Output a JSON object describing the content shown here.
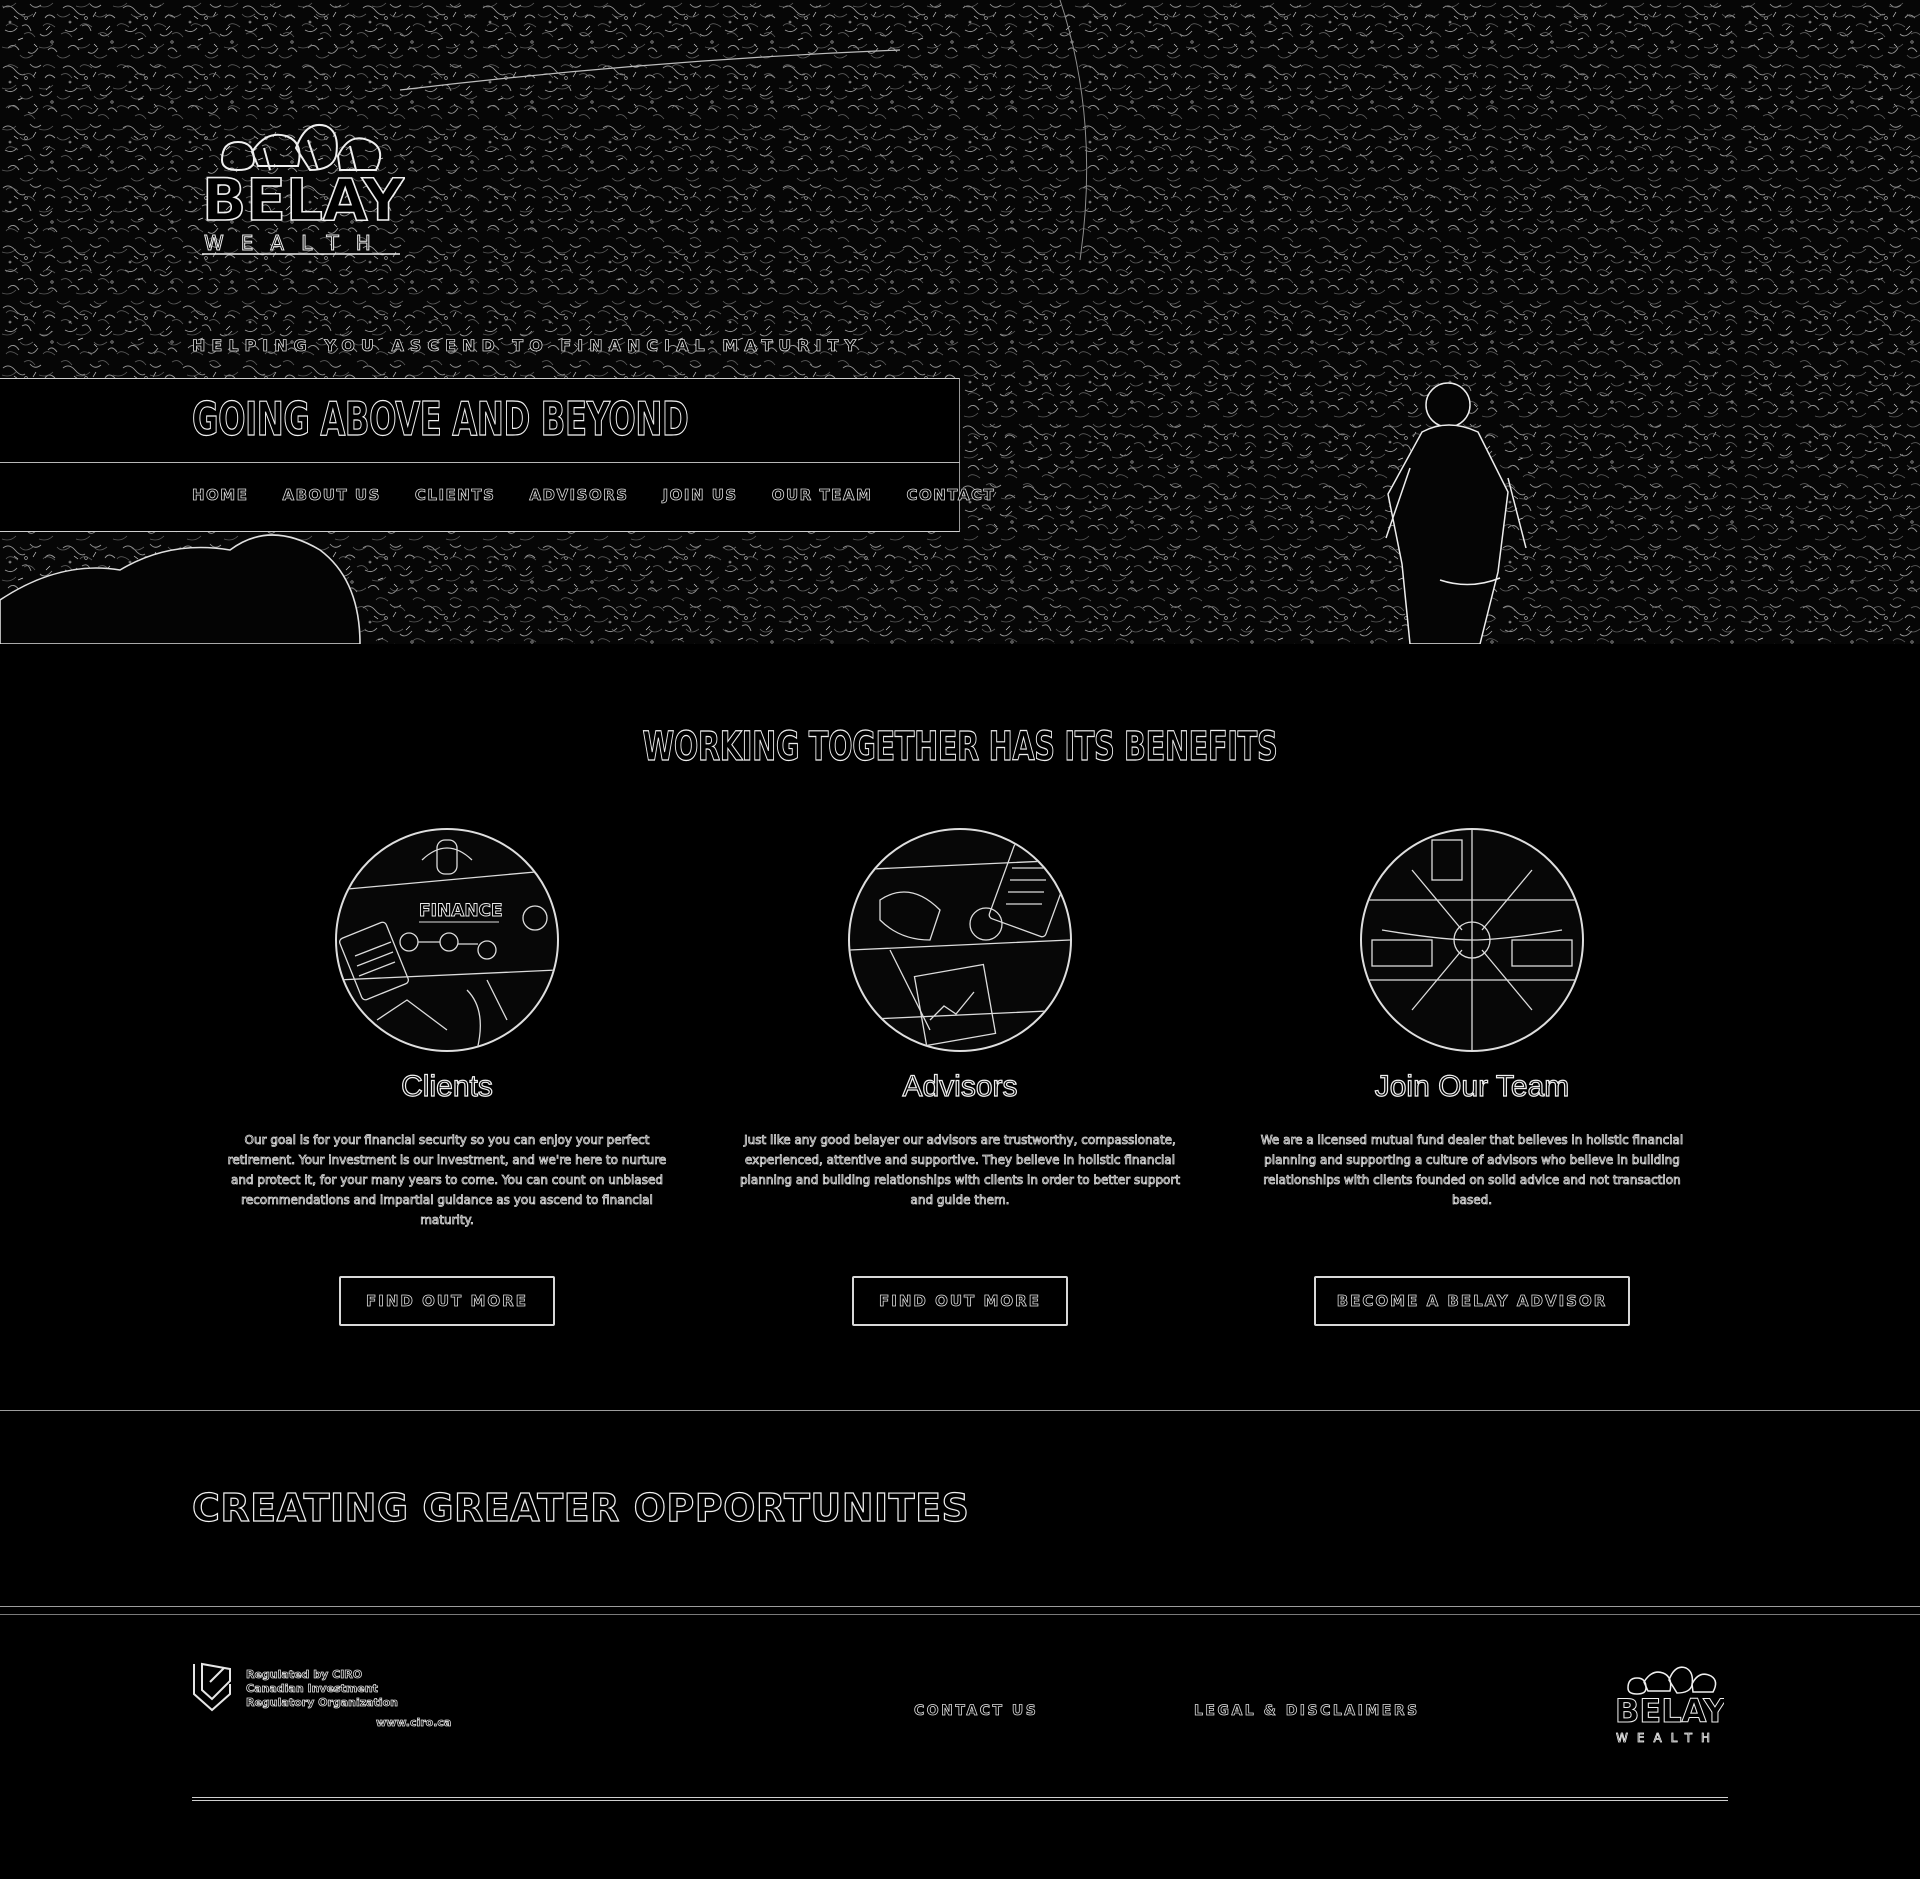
{
  "brand": {
    "name": "BELAY",
    "subname": "WEALTH"
  },
  "hero": {
    "tagline": "HELPING YOU ASCEND TO FINANCIAL MATURITY",
    "title": "GOING ABOVE AND BEYOND"
  },
  "nav": {
    "items": [
      "HOME",
      "ABOUT US",
      "CLIENTS",
      "ADVISORS",
      "JOIN US",
      "OUR TEAM",
      "CONTACT"
    ]
  },
  "benefits": {
    "title": "WORKING TOGETHER HAS ITS BENEFITS",
    "cards": [
      {
        "image_label": "FINANCE",
        "heading": "Clients",
        "text": "Our goal is for your financial security so you can enjoy your perfect retirement. Your investment is our investment, and we're here to nurture and protect it, for your many years to come. You can count on unbiased recommendations and impartial guidance as you ascend to financial maturity.",
        "button": "FIND OUT MORE"
      },
      {
        "heading": "Advisors",
        "text": "Just like any good belayer our advisors are trustworthy, compassionate, experienced, attentive and supportive. They believe in holistic financial planning and building relationships with clients in order to better support and guide them.",
        "button": "FIND OUT MORE"
      },
      {
        "heading": "Join Our Team",
        "text": "We are a licensed mutual fund dealer that believes in holistic financial planning and supporting a culture of advisors who believe in building relationships with clients founded on solid advice and not transaction based.",
        "button": "BECOME A BELAY ADVISOR"
      }
    ]
  },
  "opportunities": {
    "title": "CREATING GREATER OPPORTUNITES"
  },
  "footer": {
    "ciro_lines": [
      "Regulated by CIRO",
      "Canadian Investment",
      "Regulatory Organization"
    ],
    "ciro_url": "www.ciro.ca",
    "contact_label": "CONTACT US",
    "legal_label": "LEGAL & DISCLAIMERS"
  },
  "colors": {
    "background": "#000000",
    "line": "#e8e8e8"
  },
  "icons": {
    "logo": "carabiner-logo",
    "ciro": "ciro-shield-icon"
  }
}
